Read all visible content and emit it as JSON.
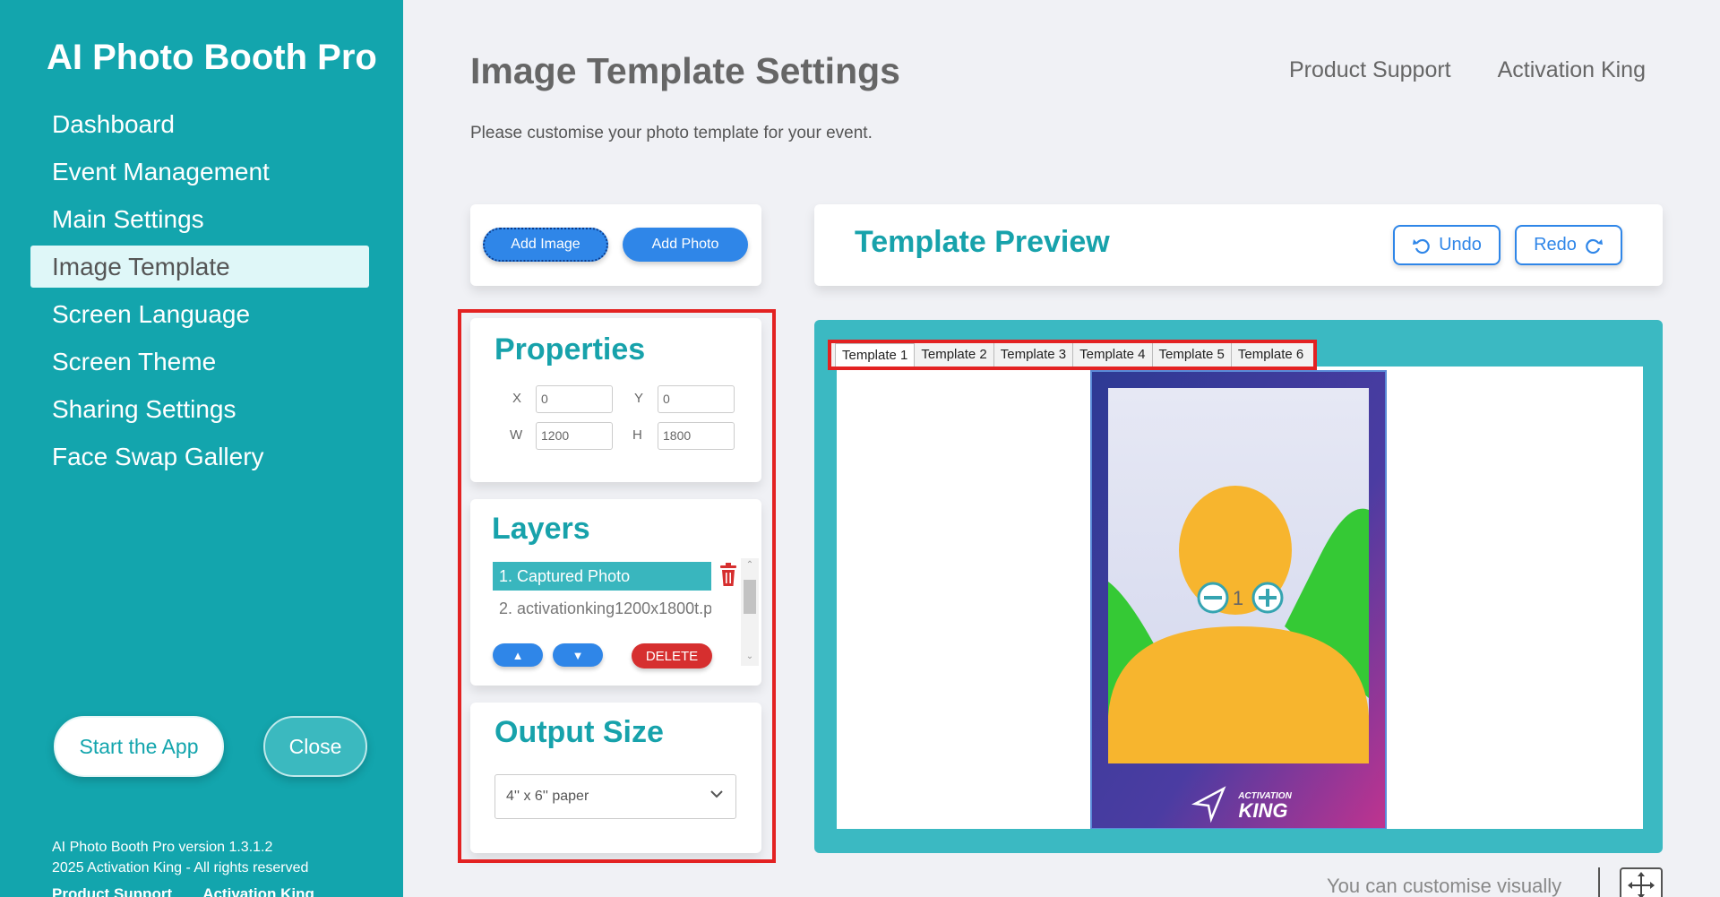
{
  "sidebar": {
    "app_title": "AI Photo Booth Pro",
    "nav": [
      {
        "label": "Dashboard",
        "active": false
      },
      {
        "label": "Event Management",
        "active": false
      },
      {
        "label": "Main Settings",
        "active": false
      },
      {
        "label": "Image Template",
        "active": true
      },
      {
        "label": "Screen Language",
        "active": false
      },
      {
        "label": "Screen Theme",
        "active": false
      },
      {
        "label": "Sharing Settings",
        "active": false
      },
      {
        "label": "Face Swap Gallery",
        "active": false
      }
    ],
    "start_label": "Start the App",
    "close_label": "Close",
    "version": "AI Photo Booth Pro version 1.3.1.2",
    "copyright": "2025 Activation King - All rights reserved",
    "footer_link_support": "Product Support",
    "footer_link_king": "Activation King"
  },
  "header": {
    "title": "Image Template Settings",
    "subtitle": "Please customise your photo template for your event.",
    "link_support": "Product Support",
    "link_king": "Activation King"
  },
  "toolbar": {
    "add_image": "Add Image",
    "add_photo": "Add Photo"
  },
  "properties": {
    "heading": "Properties",
    "x_label": "X",
    "x_value": "0",
    "y_label": "Y",
    "y_value": "0",
    "w_label": "W",
    "w_value": "1200",
    "h_label": "H",
    "h_value": "1800"
  },
  "layers": {
    "heading": "Layers",
    "items": [
      "1. Captured Photo",
      "2. activationking1200x1800t.p"
    ],
    "up_label": "▲",
    "down_label": "▼",
    "delete_label": "DELETE"
  },
  "output": {
    "heading": "Output Size",
    "selected": "4'' x 6'' paper"
  },
  "preview": {
    "title": "Template Preview",
    "undo_label": "Undo",
    "redo_label": "Redo",
    "tabs": [
      "Template 1",
      "Template 2",
      "Template 3",
      "Template 4",
      "Template 5",
      "Template 6"
    ],
    "active_tab": 0,
    "zoom_value": "1",
    "logo_small": "ACTIVATION",
    "logo_big": "KING"
  },
  "hint": "You can customise visually",
  "colors": {
    "teal": "#13a5ad",
    "accent_blue": "#2f86e8",
    "highlight_red": "#e32222"
  }
}
